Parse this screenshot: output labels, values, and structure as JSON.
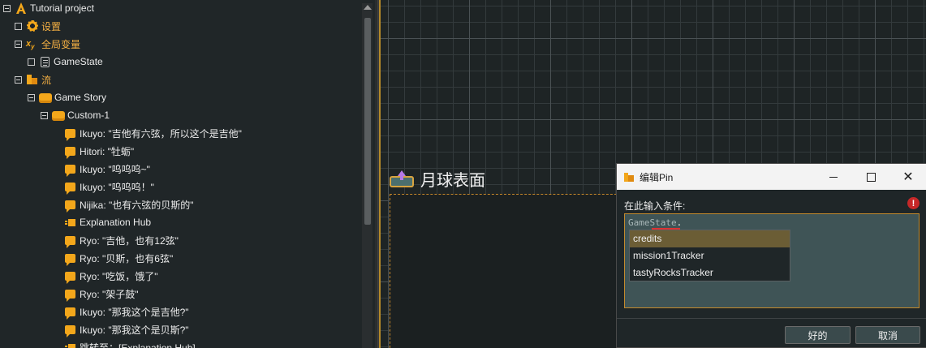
{
  "tree": {
    "items": [
      {
        "label": "Tutorial project",
        "icon": "flow-logo-icon",
        "toggle": "minus",
        "orange": false
      },
      {
        "label": "设置",
        "icon": "gear-icon",
        "toggle": "box",
        "orange": true
      },
      {
        "label": "全局变量",
        "icon": "variable-icon",
        "toggle": "minus",
        "orange": true
      },
      {
        "label": "GameState",
        "icon": "document-icon",
        "toggle": "box",
        "orange": false
      },
      {
        "label": "流",
        "icon": "flow-icon",
        "toggle": "minus",
        "orange": true
      },
      {
        "label": "Game Story",
        "icon": "flow-fragment-icon",
        "toggle": "minus",
        "orange": false
      },
      {
        "label": "Custom-1",
        "icon": "flow-fragment-icon",
        "toggle": "minus",
        "orange": false
      },
      {
        "label": "Ikuyo: \"吉他有六弦，所以这个是吉他\"",
        "icon": "dialogue-bubble-icon"
      },
      {
        "label": "Hitori: \"牡蛎\"",
        "icon": "dialogue-bubble-icon"
      },
      {
        "label": "Ikuyo: \"呜呜呜~\"",
        "icon": "dialogue-bubble-icon"
      },
      {
        "label": "Ikuyo: \"呜呜呜！\"",
        "icon": "dialogue-bubble-icon"
      },
      {
        "label": "Nijika: \"也有六弦的贝斯的\"",
        "icon": "dialogue-bubble-icon"
      },
      {
        "label": "Explanation Hub",
        "icon": "hub-icon"
      },
      {
        "label": "Ryo: \"吉他，也有12弦\"",
        "icon": "dialogue-bubble-icon"
      },
      {
        "label": "Ryo: \"贝斯，也有6弦\"",
        "icon": "dialogue-bubble-icon"
      },
      {
        "label": "Ryo: \"吃饭，饿了\"",
        "icon": "dialogue-bubble-icon"
      },
      {
        "label": "Ryo: \"架子鼓\"",
        "icon": "dialogue-bubble-icon"
      },
      {
        "label": "Ikuyo: \"那我这个是吉他?\"",
        "icon": "dialogue-bubble-icon"
      },
      {
        "label": "Ikuyo: \"那我这个是贝斯?\"",
        "icon": "dialogue-bubble-icon"
      },
      {
        "label": "跳转至：[Explanation Hub]",
        "icon": "jump-icon"
      }
    ]
  },
  "canvas": {
    "node_title": "月球表面"
  },
  "dialog": {
    "title": "编辑Pin",
    "prompt": "在此输入条件:",
    "error_symbol": "!",
    "input_text": "GameState",
    "input_dot": ".",
    "autocomplete": [
      "credits",
      "mission1Tracker",
      "tastyRocksTracker"
    ],
    "selected_index": 0,
    "ok_label": "好的",
    "cancel_label": "取消",
    "close_glyph": "✕"
  },
  "colors": {
    "accent": "#f3a71b",
    "selection": "#6b5d35",
    "error": "#c62828"
  }
}
